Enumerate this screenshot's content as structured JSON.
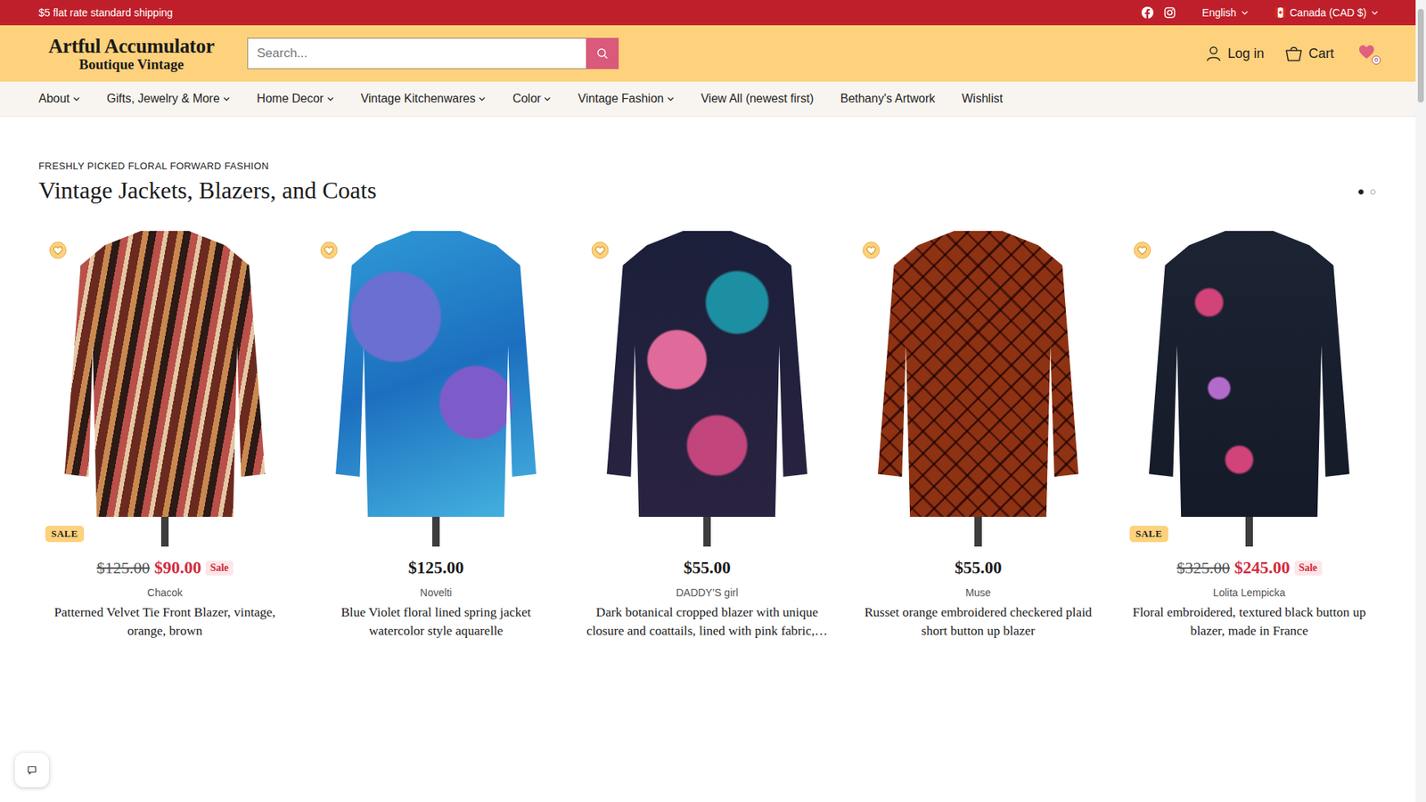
{
  "announcement": "$5 flat rate standard shipping",
  "topbar": {
    "language": "English",
    "currency": "Canada (CAD $)"
  },
  "logo": {
    "line1": "Artful Accumulator",
    "line2": "Boutique Vintage"
  },
  "search": {
    "placeholder": "Search..."
  },
  "header": {
    "login": "Log in",
    "cart": "Cart",
    "wishlist_count": "0"
  },
  "nav": [
    {
      "label": "About",
      "has_menu": true
    },
    {
      "label": "Gifts, Jewelry & More",
      "has_menu": true
    },
    {
      "label": "Home Decor",
      "has_menu": true
    },
    {
      "label": "Vintage Kitchenwares",
      "has_menu": true
    },
    {
      "label": "Color",
      "has_menu": true
    },
    {
      "label": "Vintage Fashion",
      "has_menu": true
    },
    {
      "label": "View All (newest first)",
      "has_menu": false
    },
    {
      "label": "Bethany's Artwork",
      "has_menu": false
    },
    {
      "label": "Wishlist",
      "has_menu": false
    }
  ],
  "section": {
    "eyebrow": "FRESHLY PICKED FLORAL FORWARD FASHION",
    "title": "Vintage Jackets, Blazers, and Coats",
    "pages": [
      {
        "selected": true
      },
      {
        "selected": false
      }
    ]
  },
  "products": [
    {
      "on_sale": true,
      "badge": "SALE",
      "compare_price": "$125.00",
      "price": "$90.00",
      "sale_label": "Sale",
      "brand": "Chacok",
      "title": "Patterned Velvet Tie Front Blazer, vintage, orange, brown",
      "wishlisted": false
    },
    {
      "on_sale": false,
      "price": "$125.00",
      "brand": "Novelti",
      "title": "Blue Violet floral lined spring jacket watercolor style aquarelle",
      "wishlisted": false
    },
    {
      "on_sale": false,
      "price": "$55.00",
      "brand": "DADDY'S girl",
      "title": "Dark botanical cropped blazer with unique closure and coattails, lined with pink fabric,…",
      "wishlisted": false
    },
    {
      "on_sale": false,
      "price": "$55.00",
      "brand": "Muse",
      "title": "Russet orange embroidered checkered plaid short button up blazer",
      "wishlisted": false
    },
    {
      "on_sale": true,
      "badge": "SALE",
      "compare_price": "$325.00",
      "price": "$245.00",
      "sale_label": "Sale",
      "brand": "Lolita Lempicka",
      "title": "Floral embroidered, textured black button up blazer, made in France",
      "wishlisted": false
    }
  ]
}
